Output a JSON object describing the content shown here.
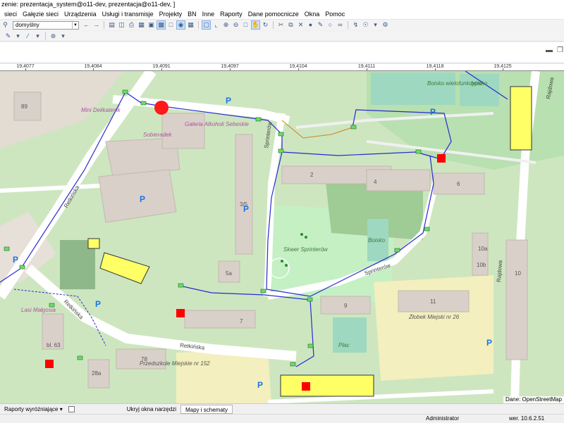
{
  "window": {
    "title": "zenie: prezentacja_system@o11-dev, prezentacja@o11-dev, ]"
  },
  "menu": [
    "sieci",
    "Gałęzie sieci",
    "Urządzenia",
    "Usługi i transmisje",
    "Projekty",
    "BN",
    "Inne",
    "Raporty",
    "Dane pomocnicze",
    "Okna",
    "Pomoc"
  ],
  "toolbar": {
    "layer_combo_value": "domyślny"
  },
  "ruler": {
    "labels": [
      "19,4077",
      "19,4084",
      "19,4091",
      "19,4097",
      "19,4104",
      "19,4111",
      "19,4118",
      "19,4125"
    ]
  },
  "map": {
    "streets": [
      "Retkińska",
      "Retkińska",
      "Retkińska",
      "Sprinterów",
      "Sprinterów",
      "Rajdowa",
      "Rajdowa"
    ],
    "places": [
      "Skwer Sprinterów",
      "Żłobek Miejski nr 26",
      "Przedszkole Miejskie nr 152",
      "Mini Delikatesik",
      "Galeria Alkoholi Sebeskie",
      "Sobieradek",
      "Lasi Małgosia",
      "Boisko wielofunkcyjne",
      "boisko",
      "Boisko",
      "Plac"
    ],
    "house_numbers": [
      "89",
      "2",
      "4",
      "6",
      "3/5",
      "5a",
      "9",
      "7",
      "11",
      "10",
      "10a",
      "10b",
      "bl. 63",
      "78",
      "28a"
    ],
    "attribution": "Dane: OpenStreetMap"
  },
  "bottom": {
    "reports_label": "Raporty wyróżniające",
    "hide_tools_label": "Ukryj okna narzędzi",
    "maps_tab_label": "Mapy i schematy"
  },
  "status": {
    "user": "Administrator",
    "version": "wer. 10.6.2.51"
  }
}
